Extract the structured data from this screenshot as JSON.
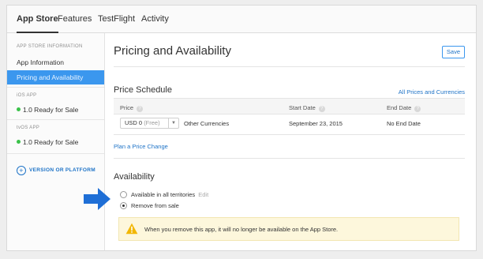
{
  "tabs": [
    {
      "label": "App Store",
      "active": true
    },
    {
      "label": "Features",
      "active": false
    },
    {
      "label": "TestFlight",
      "active": false
    },
    {
      "label": "Activity",
      "active": false
    }
  ],
  "sidebar": {
    "section_appstore": "APP STORE INFORMATION",
    "items": [
      {
        "label": "App Information"
      },
      {
        "label": "Pricing and Availability",
        "selected": true
      }
    ],
    "section_ios": "iOS APP",
    "ios_version": "1.0 Ready for Sale",
    "section_tvos": "tvOS APP",
    "tvos_version": "1.0 Ready for Sale",
    "add_platform": "VERSION OR PLATFORM",
    "status_color": "#3bc24a"
  },
  "main": {
    "title": "Pricing and Availability",
    "save_label": "Save",
    "price_schedule": {
      "title": "Price Schedule",
      "all_prices_link": "All Prices and Currencies",
      "columns": [
        "Price",
        "Start Date",
        "End Date"
      ],
      "help_glyph": "?",
      "row": {
        "price_value": "USD 0",
        "price_free": "(Free)",
        "other_currencies": "Other Currencies",
        "start_date": "September 23, 2015",
        "end_date": "No End Date"
      },
      "plan_change": "Plan a Price Change"
    },
    "availability": {
      "title": "Availability",
      "option_all": "Available in all territories",
      "edit_label": "Edit",
      "option_remove": "Remove from sale",
      "selected_option": "Remove from sale",
      "warning": "When you remove this app, it will no longer be available on the App Store."
    }
  },
  "colors": {
    "accent": "#3b97ee",
    "link": "#1e73c7",
    "warning_bg": "#fdf7dc",
    "warning_icon": "#f2b705",
    "annotation_arrow": "#1f6fd6"
  }
}
